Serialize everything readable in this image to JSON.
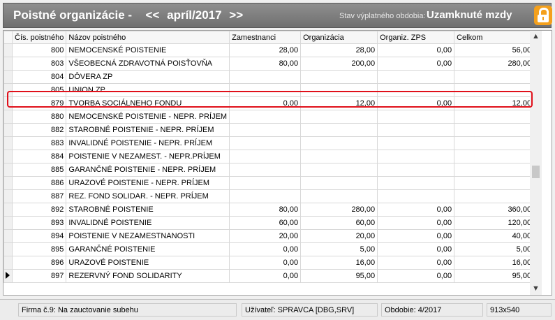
{
  "titlebar": {
    "title": "Poistné organizácie -",
    "prev": "<<",
    "period": "apríl/2017",
    "next": ">>",
    "status_label": "Stav výplatného obdobia:",
    "status_value": "Uzamknuté mzdy",
    "lock_icon": "lock-icon",
    "lock_color": "#f4a01c"
  },
  "table": {
    "columns": [
      "Čís. poistného",
      "Názov poistného",
      "Zamestnanci",
      "Organizácia",
      "Organiz. ZPS",
      "Celkom"
    ],
    "rows": [
      {
        "code": "800",
        "name": "NEMOCENSKÉ POISTENIE",
        "emp": "28,00",
        "org": "28,00",
        "zps": "0,00",
        "total": "56,00"
      },
      {
        "code": "803",
        "name": "VŠEOBECNÁ ZDRAVOTNÁ POISŤOVŇA",
        "emp": "80,00",
        "org": "200,00",
        "zps": "0,00",
        "total": "280,00"
      },
      {
        "code": "804",
        "name": "DÔVERA ZP",
        "emp": "",
        "org": "",
        "zps": "",
        "total": ""
      },
      {
        "code": "805",
        "name": "UNION ZP",
        "emp": "",
        "org": "",
        "zps": "",
        "total": ""
      },
      {
        "code": "879",
        "name": "TVORBA SOCIÁLNEHO FONDU",
        "emp": "0,00",
        "org": "12,00",
        "zps": "0,00",
        "total": "12,00"
      },
      {
        "code": "880",
        "name": "NEMOCENSKÉ POISTENIE - NEPR. PRÍJEM",
        "emp": "",
        "org": "",
        "zps": "",
        "total": ""
      },
      {
        "code": "882",
        "name": "STAROBNÉ POISTENIE - NEPR. PRÍJEM",
        "emp": "",
        "org": "",
        "zps": "",
        "total": ""
      },
      {
        "code": "883",
        "name": "INVALIDNÉ POISTENIE - NEPR. PRÍJEM",
        "emp": "",
        "org": "",
        "zps": "",
        "total": ""
      },
      {
        "code": "884",
        "name": "POISTENIE V NEZAMEST. - NEPR.PRÍJEM",
        "emp": "",
        "org": "",
        "zps": "",
        "total": ""
      },
      {
        "code": "885",
        "name": "GARANČNÉ POISTENIE - NEPR. PRÍJEM",
        "emp": "",
        "org": "",
        "zps": "",
        "total": ""
      },
      {
        "code": "886",
        "name": "URAZOVÉ POISTENIE - NEPR. PRÍJEM",
        "emp": "",
        "org": "",
        "zps": "",
        "total": ""
      },
      {
        "code": "887",
        "name": "REZ. FOND SOLIDAR. - NEPR. PRÍJEM",
        "emp": "",
        "org": "",
        "zps": "",
        "total": ""
      },
      {
        "code": "892",
        "name": "STAROBNÉ POISTENIE",
        "emp": "80,00",
        "org": "280,00",
        "zps": "0,00",
        "total": "360,00"
      },
      {
        "code": "893",
        "name": "INVALIDNÉ POISTENIE",
        "emp": "60,00",
        "org": "60,00",
        "zps": "0,00",
        "total": "120,00"
      },
      {
        "code": "894",
        "name": "POISTENIE V NEZAMESTNANOSTI",
        "emp": "20,00",
        "org": "20,00",
        "zps": "0,00",
        "total": "40,00"
      },
      {
        "code": "895",
        "name": "GARANČNÉ POISTENIE",
        "emp": "0,00",
        "org": "5,00",
        "zps": "0,00",
        "total": "5,00"
      },
      {
        "code": "896",
        "name": "URAZOVÉ POISTENIE",
        "emp": "0,00",
        "org": "16,00",
        "zps": "0,00",
        "total": "16,00"
      },
      {
        "code": "897",
        "name": "REZERVNÝ FOND SOLIDARITY",
        "emp": "0,00",
        "org": "95,00",
        "zps": "0,00",
        "total": "95,00"
      }
    ],
    "current_row_marker": "row-pointer-icon",
    "highlight_color": "#e0101a"
  },
  "statusbar": {
    "firm": "Firma č.9: Na zauctovanie subehu",
    "user": "Užívateľ: SPRAVCA [DBG,SRV]",
    "period": "Obdobie: 4/2017",
    "size": "913x540"
  }
}
